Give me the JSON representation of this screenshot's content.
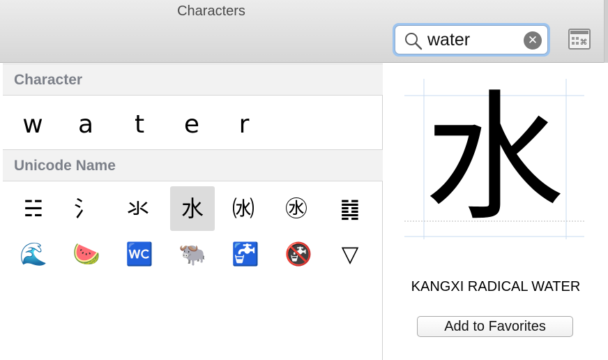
{
  "window": {
    "title": "Characters"
  },
  "search": {
    "value": "water",
    "clear_label": "✕"
  },
  "sections": {
    "character": "Character",
    "unicode_name": "Unicode Name"
  },
  "character_results": [
    "w",
    "a",
    "t",
    "e",
    "r"
  ],
  "unicode_results": [
    [
      "☵",
      "氵",
      "氺",
      "水",
      "㈬",
      "㊌",
      "䷜"
    ],
    [
      "🌊",
      "🍉",
      "🚾",
      "🐃",
      "🚰",
      "🚱",
      "▽"
    ]
  ],
  "selected": {
    "glyph": "水",
    "name": "KANGXI RADICAL WATER"
  },
  "favorites_button": "Add to Favorites"
}
